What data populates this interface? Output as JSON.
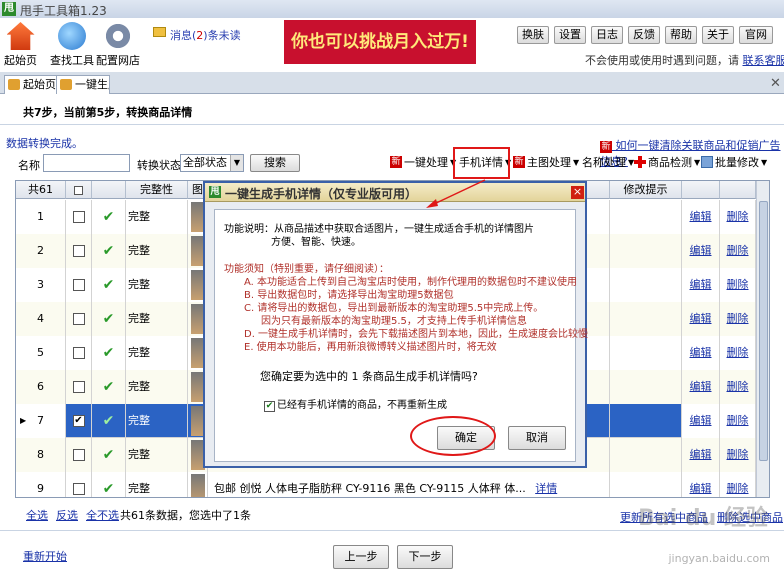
{
  "app": {
    "title": "甩手工具箱1.23",
    "icon": "甩"
  },
  "toolbar": {
    "home": "起始页",
    "find_tools": "查找工具",
    "config": "配置网店",
    "message_prefix": "消息(",
    "message_count": "2",
    "message_suffix": ")条未读",
    "banner": "你也可以挑战月入过万!",
    "skin": "换肤",
    "settings": "设置",
    "log": "日志",
    "feedback": "反馈",
    "help": "帮助",
    "about": "关于",
    "website": "官网",
    "help_text": "不会使用或使用时遇到问题，请",
    "help_link": "联系客服"
  },
  "tabs": {
    "home": "起始页",
    "current": "一键生成手机"
  },
  "step": "共7步，当前第5步，转换商品详情",
  "status_text": "数据转换完成。",
  "promo_link": "如何一键清除关联商品和促销广告信息?",
  "filter": {
    "name_label": "名称",
    "name_value": "",
    "status_label": "转换状态",
    "status_value": "全部状态",
    "search": "搜索"
  },
  "actions": {
    "one_key": "一键处理",
    "mobile_detail": "手机详情",
    "main_image": "主图处理",
    "name_process": "名称处理",
    "product_check": "商品检测",
    "batch_edit": "批量修改"
  },
  "table": {
    "headers": {
      "count": "共61",
      "complete": "完整性",
      "image": "图",
      "modify_tip": "修改提示"
    },
    "rows": [
      {
        "num": "1",
        "complete": "完整",
        "edit": "编辑",
        "delete": "删除"
      },
      {
        "num": "2",
        "complete": "完整",
        "edit": "编辑",
        "delete": "删除"
      },
      {
        "num": "3",
        "complete": "完整",
        "edit": "编辑",
        "delete": "删除"
      },
      {
        "num": "4",
        "complete": "完整",
        "edit": "编辑",
        "delete": "删除"
      },
      {
        "num": "5",
        "complete": "完整",
        "edit": "编辑",
        "delete": "删除"
      },
      {
        "num": "6",
        "complete": "完整",
        "edit": "编辑",
        "delete": "删除"
      },
      {
        "num": "7",
        "complete": "完整",
        "edit": "编辑",
        "delete": "删除"
      },
      {
        "num": "8",
        "complete": "完整",
        "edit": "编辑",
        "delete": "删除"
      },
      {
        "num": "9",
        "complete": "完整",
        "edit": "编辑",
        "delete": "删除",
        "title": "包邮 创悦 人体电子脂肪秤 CY-9116 黑色 CY-9115 人体秤 体...",
        "detail": "详情"
      }
    ]
  },
  "footer": {
    "select_all": "全选",
    "invert": "反选",
    "select_none": "全不选",
    "count_text": "共61条数据，您选中了1条",
    "update_link": "更新所有选中商品",
    "delete_link": "删除选中商品",
    "restart": "重新开始",
    "prev": "上一步",
    "next": "下一步"
  },
  "dialog": {
    "title": "一键生成手机详情（仅专业版可用）",
    "func_label": "功能说明：",
    "func_line1": "从商品描述中获取合适图片，一键生成适合手机的详情图片",
    "func_line2": "方便、智能、快速。",
    "notice_label": "功能须知（特别重要，请仔细阅读）：",
    "notice_a": "A. 本功能适合上传到自己淘宝店时使用，制作代理用的数据包时不建议使用",
    "notice_b": "B. 导出数据包时，请选择导出淘宝助理5数据包",
    "notice_c": "C. 请将导出的数据包，导出到最新版本的淘宝助理5.5中完成上传。",
    "notice_c2": "因为只有最新版本的淘宝助理5.5，才支持上传手机详情信息",
    "notice_d": "D. 一键生成手机详情时，会先下载描述图片到本地，因此，生成速度会比较慢",
    "notice_e": "E. 使用本功能后，再用新浪微博转义描述图片时，将无效",
    "confirm": "您确定要为选中的 1 条商品生成手机详情吗?",
    "skip_label": "已经有手机详情的商品，不再重新生成",
    "ok": "确定",
    "cancel": "取消"
  },
  "watermark": {
    "brand": "Bai du 经验",
    "url": "jingyan.baidu.com"
  }
}
